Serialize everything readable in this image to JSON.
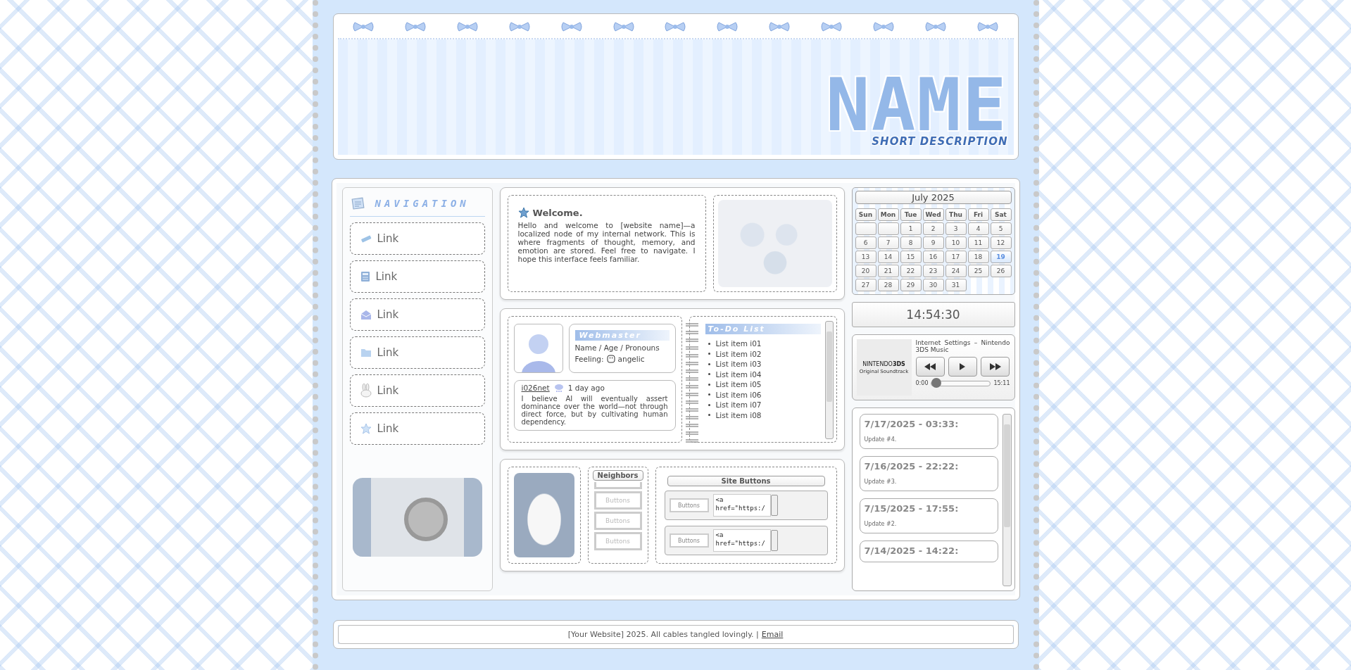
{
  "header": {
    "title": "NAME",
    "subtitle": "SHORT DESCRIPTION"
  },
  "navigation": {
    "title": "NAVIGATION",
    "links": [
      {
        "label": "Link"
      },
      {
        "label": "Link"
      },
      {
        "label": "Link"
      },
      {
        "label": "Link"
      },
      {
        "label": "Link"
      },
      {
        "label": "Link"
      }
    ]
  },
  "welcome": {
    "title": "Welcome.",
    "text": "Hello and welcome to [website name]—a localized node of my internal network. This is where fragments of thought, memory, and emotion are stored. Feel free to navigate. I hope this interface feels familiar."
  },
  "profile": {
    "heading": "Webmaster",
    "details": "Name / Age / Pronouns",
    "feeling_label": "Feeling:",
    "feeling": "angelic"
  },
  "post": {
    "author": "i026net",
    "time": "1 day ago",
    "text": "I believe AI will eventually assert dominance over the world—not through direct force, but by cultivating human dependency."
  },
  "todo": {
    "title": "To-Do List",
    "items": [
      "List item i01",
      "List item i02",
      "List item i03",
      "List item i04",
      "List item i05",
      "List item i06",
      "List item i07",
      "List item i08"
    ]
  },
  "neighbors": {
    "title": "Neighbors",
    "buttons": [
      "Buttons",
      "Buttons",
      "Buttons"
    ]
  },
  "site_buttons": {
    "title": "Site Buttons",
    "items": [
      {
        "button": "Buttons",
        "code": "<a href=\"https:/"
      },
      {
        "button": "Buttons",
        "code": "<a href=\"https:/"
      }
    ]
  },
  "calendar": {
    "month": "July 2025",
    "weekdays": [
      "Sun",
      "Mon",
      "Tue",
      "Wed",
      "Thu",
      "Fri",
      "Sat"
    ],
    "weeks": [
      {
        "days": [
          {
            "kind": "blank"
          },
          {
            "kind": "blank"
          },
          {
            "kind": "day",
            "label": "1",
            "selected": false
          },
          {
            "kind": "day",
            "label": "2",
            "selected": false
          },
          {
            "kind": "day",
            "label": "3",
            "selected": false
          },
          {
            "kind": "day",
            "label": "4",
            "selected": false
          },
          {
            "kind": "day",
            "label": "5",
            "selected": false
          }
        ]
      },
      {
        "days": [
          {
            "kind": "day",
            "label": "6",
            "selected": false
          },
          {
            "kind": "day",
            "label": "7",
            "selected": false
          },
          {
            "kind": "day",
            "label": "8",
            "selected": false
          },
          {
            "kind": "day",
            "label": "9",
            "selected": false
          },
          {
            "kind": "day",
            "label": "10",
            "selected": false
          },
          {
            "kind": "day",
            "label": "11",
            "selected": false
          },
          {
            "kind": "day",
            "label": "12",
            "selected": false
          }
        ]
      },
      {
        "days": [
          {
            "kind": "day",
            "label": "13",
            "selected": false
          },
          {
            "kind": "day",
            "label": "14",
            "selected": false
          },
          {
            "kind": "day",
            "label": "15",
            "selected": false
          },
          {
            "kind": "day",
            "label": "16",
            "selected": false
          },
          {
            "kind": "day",
            "label": "17",
            "selected": false
          },
          {
            "kind": "day",
            "label": "18",
            "selected": false
          },
          {
            "kind": "day",
            "label": "19",
            "selected": true
          }
        ]
      },
      {
        "days": [
          {
            "kind": "day",
            "label": "20",
            "selected": false
          },
          {
            "kind": "day",
            "label": "21",
            "selected": false
          },
          {
            "kind": "day",
            "label": "22",
            "selected": false
          },
          {
            "kind": "day",
            "label": "23",
            "selected": false
          },
          {
            "kind": "day",
            "label": "24",
            "selected": false
          },
          {
            "kind": "day",
            "label": "25",
            "selected": false
          },
          {
            "kind": "day",
            "label": "26",
            "selected": false
          }
        ]
      },
      {
        "days": [
          {
            "kind": "day",
            "label": "27",
            "selected": false
          },
          {
            "kind": "day",
            "label": "28",
            "selected": false
          },
          {
            "kind": "day",
            "label": "29",
            "selected": false
          },
          {
            "kind": "day",
            "label": "30",
            "selected": false
          },
          {
            "kind": "day",
            "label": "31",
            "selected": false
          }
        ]
      }
    ]
  },
  "clock": {
    "time": "14:54:30"
  },
  "player": {
    "track": "Internet Settings – Nintendo 3DS Music",
    "album_logo": "NINTENDO**3DS**",
    "album_subtitle": "Original Soundtrack",
    "elapsed": "0:00",
    "duration": "15:11",
    "level": 0
  },
  "updates": [
    {
      "date": "7/17/2025 - 03:33:",
      "text": "Update #4."
    },
    {
      "date": "7/16/2025 - 22:22:",
      "text": "Update #3."
    },
    {
      "date": "7/15/2025 - 17:55:",
      "text": "Update #2."
    },
    {
      "date": "7/14/2025 - 14:22:"
    }
  ],
  "footer": {
    "text": "[Your Website] 2025. All cables tangled lovingly. |",
    "link": "Email"
  }
}
